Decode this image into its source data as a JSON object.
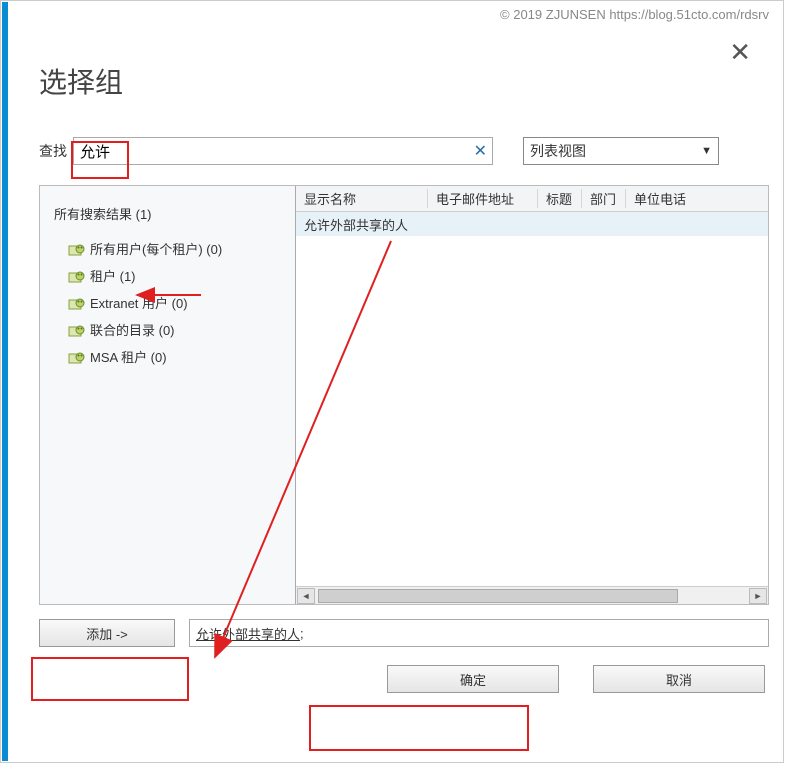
{
  "watermark": "© 2019 ZJUNSEN https://blog.51cto.com/rdsrv",
  "dialog": {
    "title": "选择组",
    "search_label": "查找",
    "search_value": "允许",
    "view_mode": "列表视图",
    "tree": {
      "title": "所有搜索结果 (1)",
      "items": [
        {
          "label": "所有用户(每个租户) (0)"
        },
        {
          "label": "租户 (1)"
        },
        {
          "label": "Extranet 用户 (0)"
        },
        {
          "label": "联合的目录 (0)"
        },
        {
          "label": "MSA 租户 (0)"
        }
      ]
    },
    "grid": {
      "columns": {
        "display_name": "显示名称",
        "email": "电子邮件地址",
        "title": "标题",
        "dept": "部门",
        "phone": "单位电话"
      },
      "row0_display_name": "允许外部共享的人"
    },
    "add_button": "添加 ->",
    "selected_value": "允许外部共享的人",
    "ok_button": "确定",
    "cancel_button": "取消"
  }
}
